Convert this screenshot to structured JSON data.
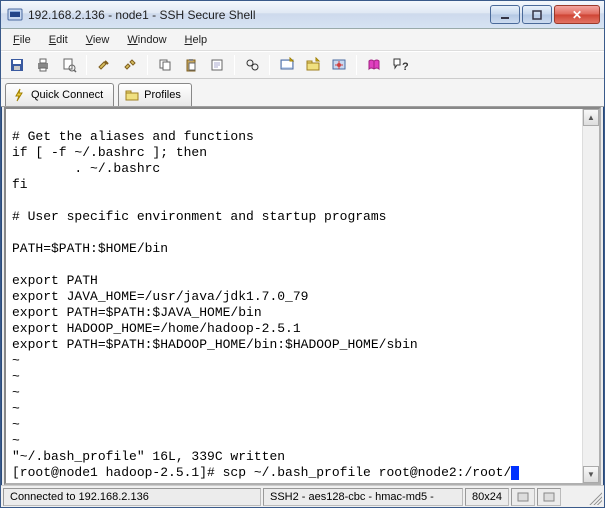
{
  "window": {
    "title": "192.168.2.136 - node1 - SSH Secure Shell"
  },
  "menu": {
    "file": "File",
    "edit": "Edit",
    "view": "View",
    "window": "Window",
    "help": "Help"
  },
  "toolbar2": {
    "quick_connect": "Quick Connect",
    "profiles": "Profiles"
  },
  "terminal": {
    "lines": [
      "",
      "# Get the aliases and functions",
      "if [ -f ~/.bashrc ]; then",
      "        . ~/.bashrc",
      "fi",
      "",
      "# User specific environment and startup programs",
      "",
      "PATH=$PATH:$HOME/bin",
      "",
      "export PATH",
      "export JAVA_HOME=/usr/java/jdk1.7.0_79",
      "export PATH=$PATH:$JAVA_HOME/bin",
      "export HADOOP_HOME=/home/hadoop-2.5.1",
      "export PATH=$PATH:$HADOOP_HOME/bin:$HADOOP_HOME/sbin",
      "~",
      "~",
      "~",
      "~",
      "~",
      "~",
      "\"~/.bash_profile\" 16L, 339C written"
    ],
    "prompt": "[root@node1 hadoop-2.5.1]# scp ~/.bash_profile root@node2:/root/"
  },
  "status": {
    "left": "Connected to 192.168.2.136",
    "mid": "SSH2 - aes128-cbc - hmac-md5 -",
    "size": "80x24"
  }
}
